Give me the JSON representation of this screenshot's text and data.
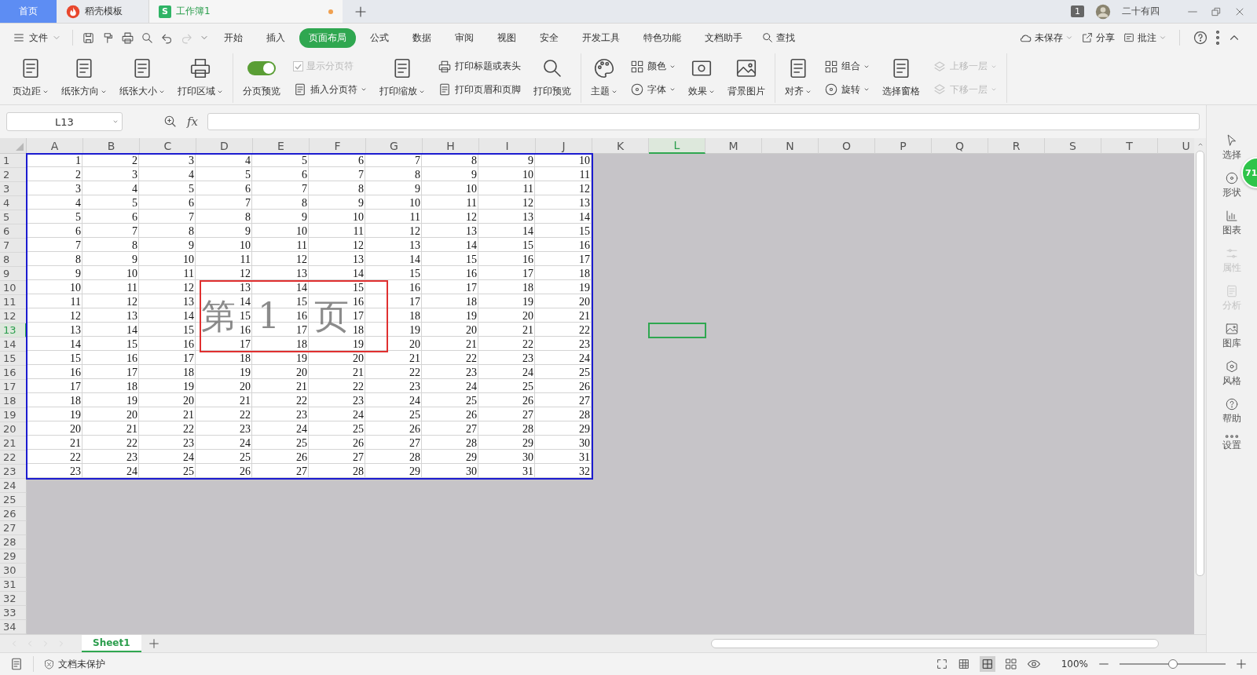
{
  "title_tabs": [
    {
      "kind": "home",
      "label": "首页",
      "selected": false
    },
    {
      "kind": "template",
      "label": "稻壳模板",
      "selected": false
    },
    {
      "kind": "workbook",
      "label": "工作簿1",
      "logo_text": "S",
      "modified": true,
      "selected": true
    }
  ],
  "window_count": "1",
  "user_name": "二十有四",
  "quick_access": [
    {
      "disabled": false
    },
    {
      "disabled": false
    },
    {
      "disabled": false
    },
    {
      "disabled": false
    },
    {
      "disabled": false
    },
    {
      "disabled": true
    },
    {
      "disabled": false
    }
  ],
  "menu": {
    "file": "文件",
    "tabs": [
      {
        "label": "开始",
        "selected": false
      },
      {
        "label": "插入",
        "selected": false
      },
      {
        "label": "页面布局",
        "selected": true
      },
      {
        "label": "公式",
        "selected": false
      },
      {
        "label": "数据",
        "selected": false
      },
      {
        "label": "审阅",
        "selected": false
      },
      {
        "label": "视图",
        "selected": false
      },
      {
        "label": "安全",
        "selected": false
      },
      {
        "label": "开发工具",
        "selected": false
      },
      {
        "label": "特色功能",
        "selected": false
      },
      {
        "label": "文档助手",
        "selected": false
      }
    ],
    "find": "查找",
    "unsaved": "未保存",
    "share": "分享",
    "comment": "批注"
  },
  "ribbon": [
    {
      "items": [
        {
          "kind": "large",
          "label": "页边距",
          "dropdown": true
        },
        {
          "kind": "large",
          "label": "纸张方向",
          "dropdown": true
        },
        {
          "kind": "large",
          "label": "纸张大小",
          "dropdown": true
        },
        {
          "kind": "large",
          "label": "打印区域",
          "dropdown": true
        }
      ]
    },
    {
      "items": [
        {
          "kind": "toggle",
          "label": "分页预览",
          "on": true
        },
        {
          "kind": "stack",
          "items": [
            {
              "kind": "check",
              "label": "显示分页符",
              "checked": true,
              "disabled": true
            },
            {
              "kind": "small",
              "label": "插入分页符",
              "dropdown": true,
              "disabled": false
            }
          ]
        },
        {
          "kind": "large",
          "label": "打印缩放",
          "dropdown": true
        },
        {
          "kind": "stack",
          "items": [
            {
              "kind": "small",
              "label": "打印标题或表头",
              "dropdown": false,
              "disabled": false
            },
            {
              "kind": "small",
              "label": "打印页眉和页脚",
              "dropdown": false,
              "disabled": false
            }
          ]
        },
        {
          "kind": "large",
          "label": "打印预览",
          "dropdown": false
        }
      ]
    },
    {
      "items": [
        {
          "kind": "large",
          "label": "主题",
          "dropdown": true
        },
        {
          "kind": "stack",
          "items": [
            {
              "kind": "small",
              "label": "颜色",
              "dropdown": true,
              "disabled": false
            },
            {
              "kind": "small",
              "label": "字体",
              "dropdown": true,
              "disabled": false
            }
          ]
        },
        {
          "kind": "large",
          "label": "效果",
          "dropdown": true
        },
        {
          "kind": "large",
          "label": "背景图片",
          "dropdown": false
        }
      ]
    },
    {
      "items": [
        {
          "kind": "large",
          "label": "对齐",
          "dropdown": true
        },
        {
          "kind": "stack",
          "items": [
            {
              "kind": "small",
              "label": "组合",
              "dropdown": true,
              "disabled": false
            },
            {
              "kind": "small",
              "label": "旋转",
              "dropdown": true,
              "disabled": false
            }
          ]
        },
        {
          "kind": "large",
          "label": "选择窗格",
          "dropdown": false
        },
        {
          "kind": "stack",
          "items": [
            {
              "kind": "small",
              "label": "上移一层",
              "dropdown": true,
              "disabled": true
            },
            {
              "kind": "small",
              "label": "下移一层",
              "dropdown": true,
              "disabled": true
            }
          ]
        }
      ]
    }
  ],
  "name_box": "L13",
  "fx": "fx",
  "columns": [
    {
      "label": "A",
      "selected": false
    },
    {
      "label": "B",
      "selected": false
    },
    {
      "label": "C",
      "selected": false
    },
    {
      "label": "D",
      "selected": false
    },
    {
      "label": "E",
      "selected": false
    },
    {
      "label": "F",
      "selected": false
    },
    {
      "label": "G",
      "selected": false
    },
    {
      "label": "H",
      "selected": false
    },
    {
      "label": "I",
      "selected": false
    },
    {
      "label": "J",
      "selected": false
    },
    {
      "label": "K",
      "selected": false
    },
    {
      "label": "L",
      "selected": true
    },
    {
      "label": "M",
      "selected": false
    },
    {
      "label": "N",
      "selected": false
    },
    {
      "label": "O",
      "selected": false
    },
    {
      "label": "P",
      "selected": false
    },
    {
      "label": "Q",
      "selected": false
    },
    {
      "label": "R",
      "selected": false
    },
    {
      "label": "S",
      "selected": false
    },
    {
      "label": "T",
      "selected": false
    },
    {
      "label": "U",
      "selected": false
    }
  ],
  "rows": [
    {
      "header": "1",
      "selected": false,
      "cells": [
        "1",
        "2",
        "3",
        "4",
        "5",
        "6",
        "7",
        "8",
        "9",
        "10"
      ]
    },
    {
      "header": "2",
      "selected": false,
      "cells": [
        "2",
        "3",
        "4",
        "5",
        "6",
        "7",
        "8",
        "9",
        "10",
        "11"
      ]
    },
    {
      "header": "3",
      "selected": false,
      "cells": [
        "3",
        "4",
        "5",
        "6",
        "7",
        "8",
        "9",
        "10",
        "11",
        "12"
      ]
    },
    {
      "header": "4",
      "selected": false,
      "cells": [
        "4",
        "5",
        "6",
        "7",
        "8",
        "9",
        "10",
        "11",
        "12",
        "13"
      ]
    },
    {
      "header": "5",
      "selected": false,
      "cells": [
        "5",
        "6",
        "7",
        "8",
        "9",
        "10",
        "11",
        "12",
        "13",
        "14"
      ]
    },
    {
      "header": "6",
      "selected": false,
      "cells": [
        "6",
        "7",
        "8",
        "9",
        "10",
        "11",
        "12",
        "13",
        "14",
        "15"
      ]
    },
    {
      "header": "7",
      "selected": false,
      "cells": [
        "7",
        "8",
        "9",
        "10",
        "11",
        "12",
        "13",
        "14",
        "15",
        "16"
      ]
    },
    {
      "header": "8",
      "selected": false,
      "cells": [
        "8",
        "9",
        "10",
        "11",
        "12",
        "13",
        "14",
        "15",
        "16",
        "17"
      ]
    },
    {
      "header": "9",
      "selected": false,
      "cells": [
        "9",
        "10",
        "11",
        "12",
        "13",
        "14",
        "15",
        "16",
        "17",
        "18"
      ]
    },
    {
      "header": "10",
      "selected": false,
      "cells": [
        "10",
        "11",
        "12",
        "13",
        "14",
        "15",
        "16",
        "17",
        "18",
        "19"
      ]
    },
    {
      "header": "11",
      "selected": false,
      "cells": [
        "11",
        "12",
        "13",
        "14",
        "15",
        "16",
        "17",
        "18",
        "19",
        "20"
      ]
    },
    {
      "header": "12",
      "selected": false,
      "cells": [
        "12",
        "13",
        "14",
        "15",
        "16",
        "17",
        "18",
        "19",
        "20",
        "21"
      ]
    },
    {
      "header": "13",
      "selected": true,
      "cells": [
        "13",
        "14",
        "15",
        "16",
        "17",
        "18",
        "19",
        "20",
        "21",
        "22"
      ]
    },
    {
      "header": "14",
      "selected": false,
      "cells": [
        "14",
        "15",
        "16",
        "17",
        "18",
        "19",
        "20",
        "21",
        "22",
        "23"
      ]
    },
    {
      "header": "15",
      "selected": false,
      "cells": [
        "15",
        "16",
        "17",
        "18",
        "19",
        "20",
        "21",
        "22",
        "23",
        "24"
      ]
    },
    {
      "header": "16",
      "selected": false,
      "cells": [
        "16",
        "17",
        "18",
        "19",
        "20",
        "21",
        "22",
        "23",
        "24",
        "25"
      ]
    },
    {
      "header": "17",
      "selected": false,
      "cells": [
        "17",
        "18",
        "19",
        "20",
        "21",
        "22",
        "23",
        "24",
        "25",
        "26"
      ]
    },
    {
      "header": "18",
      "selected": false,
      "cells": [
        "18",
        "19",
        "20",
        "21",
        "22",
        "23",
        "24",
        "25",
        "26",
        "27"
      ]
    },
    {
      "header": "19",
      "selected": false,
      "cells": [
        "19",
        "20",
        "21",
        "22",
        "23",
        "24",
        "25",
        "26",
        "27",
        "28"
      ]
    },
    {
      "header": "20",
      "selected": false,
      "cells": [
        "20",
        "21",
        "22",
        "23",
        "24",
        "25",
        "26",
        "27",
        "28",
        "29"
      ]
    },
    {
      "header": "21",
      "selected": false,
      "cells": [
        "21",
        "22",
        "23",
        "24",
        "25",
        "26",
        "27",
        "28",
        "29",
        "30"
      ]
    },
    {
      "header": "22",
      "selected": false,
      "cells": [
        "22",
        "23",
        "24",
        "25",
        "26",
        "27",
        "28",
        "29",
        "30",
        "31"
      ]
    },
    {
      "header": "23",
      "selected": false,
      "cells": [
        "23",
        "24",
        "25",
        "26",
        "27",
        "28",
        "29",
        "30",
        "31",
        "32"
      ]
    },
    {
      "header": "24",
      "selected": false
    },
    {
      "header": "25",
      "selected": false
    },
    {
      "header": "26",
      "selected": false
    },
    {
      "header": "27",
      "selected": false
    },
    {
      "header": "28",
      "selected": false
    },
    {
      "header": "29",
      "selected": false
    },
    {
      "header": "30",
      "selected": false
    },
    {
      "header": "31",
      "selected": false
    },
    {
      "header": "32",
      "selected": false
    },
    {
      "header": "33",
      "selected": false
    },
    {
      "header": "34",
      "selected": false
    }
  ],
  "page_label": [
    "第",
    "1",
    "页"
  ],
  "floating_badge": "71",
  "sidebar": [
    {
      "label": "选择",
      "disabled": false
    },
    {
      "label": "形状",
      "disabled": false
    },
    {
      "label": "图表",
      "disabled": false
    },
    {
      "label": "属性",
      "disabled": true
    },
    {
      "label": "分析",
      "disabled": true
    },
    {
      "label": "图库",
      "disabled": false
    },
    {
      "label": "风格",
      "disabled": false
    },
    {
      "label": "帮助",
      "disabled": false
    },
    {
      "label": "设置",
      "disabled": false
    }
  ],
  "sheets": [
    {
      "label": "Sheet1",
      "selected": true
    }
  ],
  "status": {
    "protection": "文档未保护",
    "zoom": "100%",
    "zoom_slider": {
      "level": 0.5
    }
  }
}
